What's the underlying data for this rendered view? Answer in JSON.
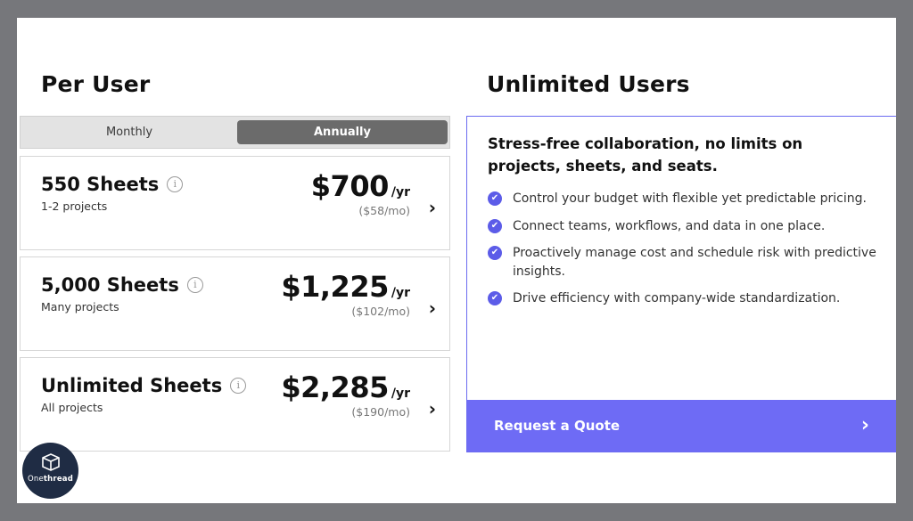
{
  "per_user": {
    "heading": "Per User",
    "toggle": {
      "monthly": "Monthly",
      "annually": "Annually",
      "selected": "Annually"
    },
    "plans": [
      {
        "name": "550 Sheets",
        "sub": "1-2 projects",
        "price": "$700",
        "per": "/yr",
        "monthly": "($58/mo)"
      },
      {
        "name": "5,000 Sheets",
        "sub": "Many projects",
        "price": "$1,225",
        "per": "/yr",
        "monthly": "($102/mo)"
      },
      {
        "name": "Unlimited Sheets",
        "sub": "All projects",
        "price": "$2,285",
        "per": "/yr",
        "monthly": "($190/mo)"
      }
    ]
  },
  "unlimited_users": {
    "heading": "Unlimited Users",
    "lead": "Stress-free collaboration, no limits on projects, sheets, and seats.",
    "bullets": [
      "Control your budget with flexible yet predictable pricing.",
      "Connect teams, workflows, and data in one place.",
      "Proactively manage cost and schedule risk with predictive insights.",
      "Drive efficiency with company-wide standardization."
    ],
    "cta": "Request a Quote"
  },
  "icons": {
    "info": "info-icon",
    "chevron": "chevron-right-icon",
    "check": "check-circle-icon"
  },
  "colors": {
    "accent": "#6e6bf5",
    "check": "#5c5ce8",
    "toggle_active": "#6b6b6b",
    "background": "#76777b"
  },
  "logo": {
    "text_a": "One",
    "text_b": "thread"
  }
}
